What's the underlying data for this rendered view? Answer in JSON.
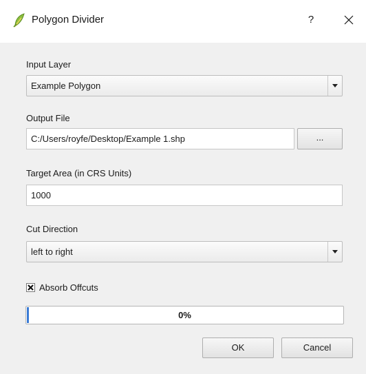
{
  "window": {
    "title": "Polygon Divider",
    "help_label": "?",
    "app_icon": "qgis-leaf-icon",
    "close_icon": "close-x-icon"
  },
  "input_layer": {
    "label": "Input Layer",
    "selected": "Example Polygon"
  },
  "output_file": {
    "label": "Output File",
    "value": "C:/Users/royfe/Desktop/Example 1.shp",
    "browse_label": "..."
  },
  "target_area": {
    "label": "Target Area (in CRS Units)",
    "value": "1000"
  },
  "cut_direction": {
    "label": "Cut Direction",
    "selected": "left to right"
  },
  "absorb_offcuts": {
    "label": "Absorb Offcuts",
    "checked": true
  },
  "progress": {
    "text": "0%",
    "fraction": 0.0,
    "fill_color": "#3a7bd5"
  },
  "buttons": {
    "ok": "OK",
    "cancel": "Cancel"
  }
}
